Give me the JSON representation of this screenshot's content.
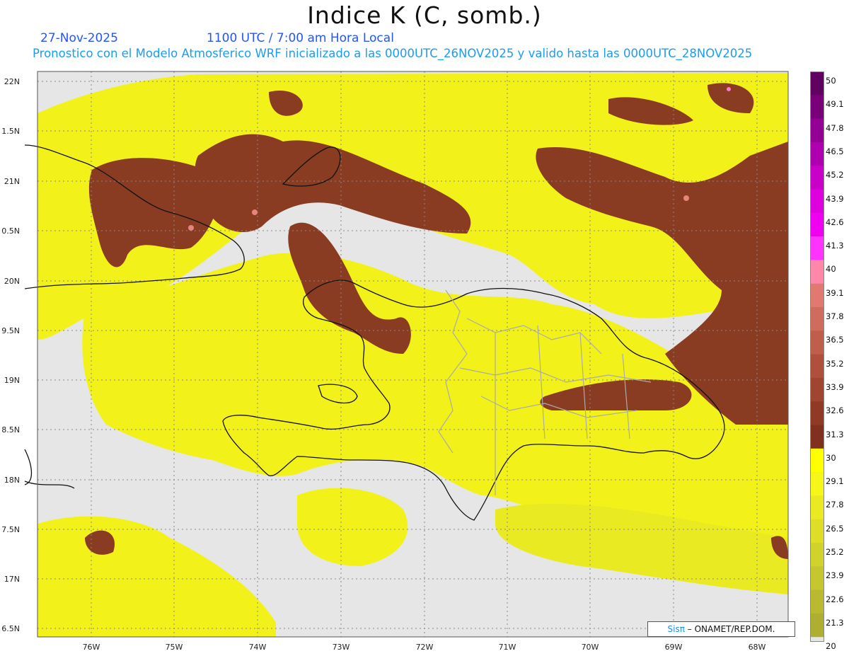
{
  "header": {
    "title": "Indice K (C, somb.)",
    "date": "27-Nov-2025",
    "utc_time": "1100 UTC / 7:00 am Hora Local",
    "forecast_text": "Pronostico con el Modelo Atmosferico WRF inicializado a las 0000UTC_26NOV2025 y valido hasta las  0000UTC_28NOV2025"
  },
  "map": {
    "lat_labels": [
      "22N",
      "1.5N",
      "21N",
      "0.5N",
      "20N",
      "9.5N",
      "19N",
      "8.5N",
      "18N",
      "7.5N",
      "17N",
      "6.5N"
    ],
    "lon_labels": [
      "76W",
      "75W",
      "74W",
      "73W",
      "72W",
      "71W",
      "70W",
      "69W",
      "68W"
    ],
    "colors": {
      "background": "#e6e6e6",
      "yellow": "#f2f21a",
      "brown": "#8a3c22",
      "coast": "#111111",
      "provinces": "#aaaaaa",
      "grid": "#888888"
    }
  },
  "colorbar": {
    "labels": [
      "50",
      "49.1",
      "47.8",
      "46.5",
      "45.2",
      "43.9",
      "42.6",
      "41.3",
      "40",
      "39.1",
      "37.8",
      "36.5",
      "35.2",
      "33.9",
      "32.6",
      "31.3",
      "30",
      "29.1",
      "27.8",
      "26.5",
      "25.2",
      "23.9",
      "22.6",
      "21.3",
      "20"
    ],
    "colors": [
      "#600060",
      "#7a007a",
      "#940094",
      "#ae00ae",
      "#c800c8",
      "#de00de",
      "#f000f0",
      "#ff33ff",
      "#ff88aa",
      "#e07a70",
      "#d06c5e",
      "#c05e4c",
      "#b0503c",
      "#a04530",
      "#903a26",
      "#80301c",
      "#ffff00",
      "#f6f618",
      "#eaea22",
      "#dede28",
      "#d2d22c",
      "#c6c62e",
      "#baba30",
      "#aeae30"
    ]
  },
  "credit": {
    "brand": "Sisπ",
    "text": " – ONAMET/REP.DOM."
  }
}
